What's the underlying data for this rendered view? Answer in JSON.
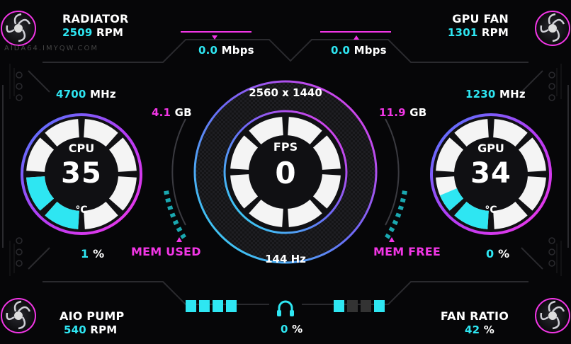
{
  "colors": {
    "cyan": "#2ee6f2",
    "magenta": "#f236e6",
    "white": "#ffffff",
    "background": "#060608"
  },
  "radiator": {
    "label": "RADIATOR",
    "value": "2509",
    "unit": "RPM"
  },
  "gpu_fan": {
    "label": "GPU FAN",
    "value": "1301",
    "unit": "RPM"
  },
  "aio_pump": {
    "label": "AIO PUMP",
    "value": "540",
    "unit": "RPM"
  },
  "fan_ratio": {
    "label": "FAN RATIO",
    "value": "42",
    "unit": "%"
  },
  "net_left": {
    "value": "0.0",
    "unit": "Mbps",
    "icon": "arrow-down-icon"
  },
  "net_right": {
    "value": "0.0",
    "unit": "Mbps",
    "icon": "arrow-up-icon"
  },
  "cpu": {
    "clock_value": "4700",
    "clock_unit": "MHz",
    "title": "CPU",
    "temp": "35",
    "temp_unit": "°C",
    "load_value": "1",
    "load_unit": "%",
    "level": 0.35
  },
  "gpu": {
    "clock_value": "1230",
    "clock_unit": "MHz",
    "title": "GPU",
    "temp": "34",
    "temp_unit": "°C",
    "load_value": "0",
    "load_unit": "%",
    "level": 0.34
  },
  "center": {
    "resolution": "2560 x 1440",
    "title": "FPS",
    "fps": "0",
    "refresh": "144 Hz"
  },
  "mem_used": {
    "value": "4.1",
    "unit": "GB",
    "label": "MEM USED"
  },
  "mem_free": {
    "value": "11.9",
    "unit": "GB",
    "label": "MEM FREE"
  },
  "audio": {
    "icon": "headphones-icon",
    "value": "0",
    "unit": "%"
  },
  "bars_left": {
    "segments": [
      true,
      true,
      true,
      true
    ]
  },
  "bars_right": {
    "segments": [
      true,
      false,
      false,
      true
    ]
  },
  "watermark": {
    "text": "AIDA64.IMYQW.COM"
  }
}
